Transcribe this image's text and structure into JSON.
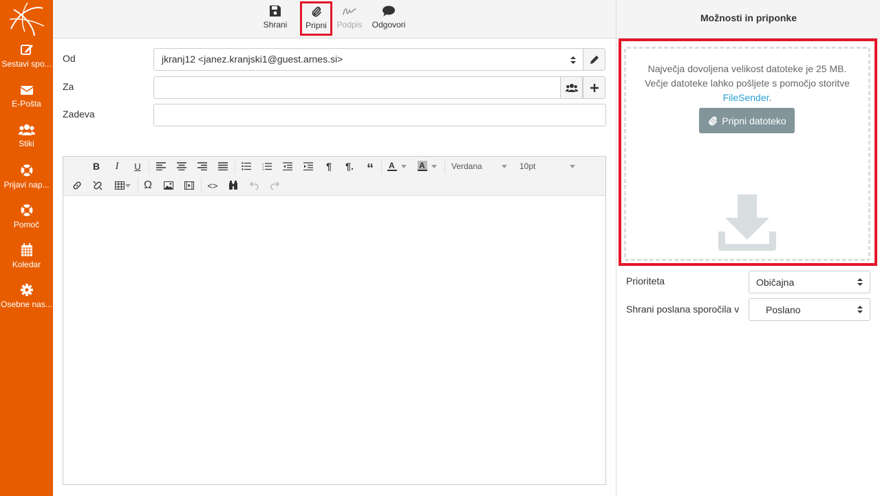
{
  "sidebar": {
    "items": [
      {
        "label": "Sestavi spo...",
        "icon": "compose-icon"
      },
      {
        "label": "E-Pošta",
        "icon": "envelope-icon"
      },
      {
        "label": "Stiki",
        "icon": "users-icon"
      },
      {
        "label": "Prijavi nap...",
        "icon": "lifebuoy-icon"
      },
      {
        "label": "Pomoč",
        "icon": "lifebuoy-icon"
      },
      {
        "label": "Koledar",
        "icon": "calendar-icon"
      },
      {
        "label": "Osebne nas...",
        "icon": "gear-icon"
      }
    ]
  },
  "toolbar": {
    "save_label": "Shrani",
    "attach_label": "Pripni",
    "signature_label": "Podpis",
    "responses_label": "Odgovori"
  },
  "form": {
    "from_label": "Od",
    "from_value": "jkranj12 <janez.kranjski1@guest.arnes.si>",
    "to_label": "Za",
    "to_value": "",
    "subject_label": "Zadeva",
    "subject_value": ""
  },
  "editor": {
    "font_family": "Verdana",
    "font_size": "10pt"
  },
  "right_panel": {
    "title": "Možnosti in priponke",
    "max_size_text": "Največja dovoljena velikost datoteke je 25 MB.",
    "larger_files_text": "Večje datoteke lahko pošljete s pomočjo storitve",
    "filesender_link": "FileSender",
    "period": ".",
    "attach_button": "Pripni datoteko",
    "priority_label": "Prioriteta",
    "priority_value": "Običajna",
    "save_sent_label": "Shrani poslana sporočila v",
    "save_sent_value": "Poslano"
  },
  "colors": {
    "sidebar": "#e85c00",
    "highlight": "#e3162a",
    "link": "#2a9fd6",
    "attach_button": "#81959a"
  }
}
